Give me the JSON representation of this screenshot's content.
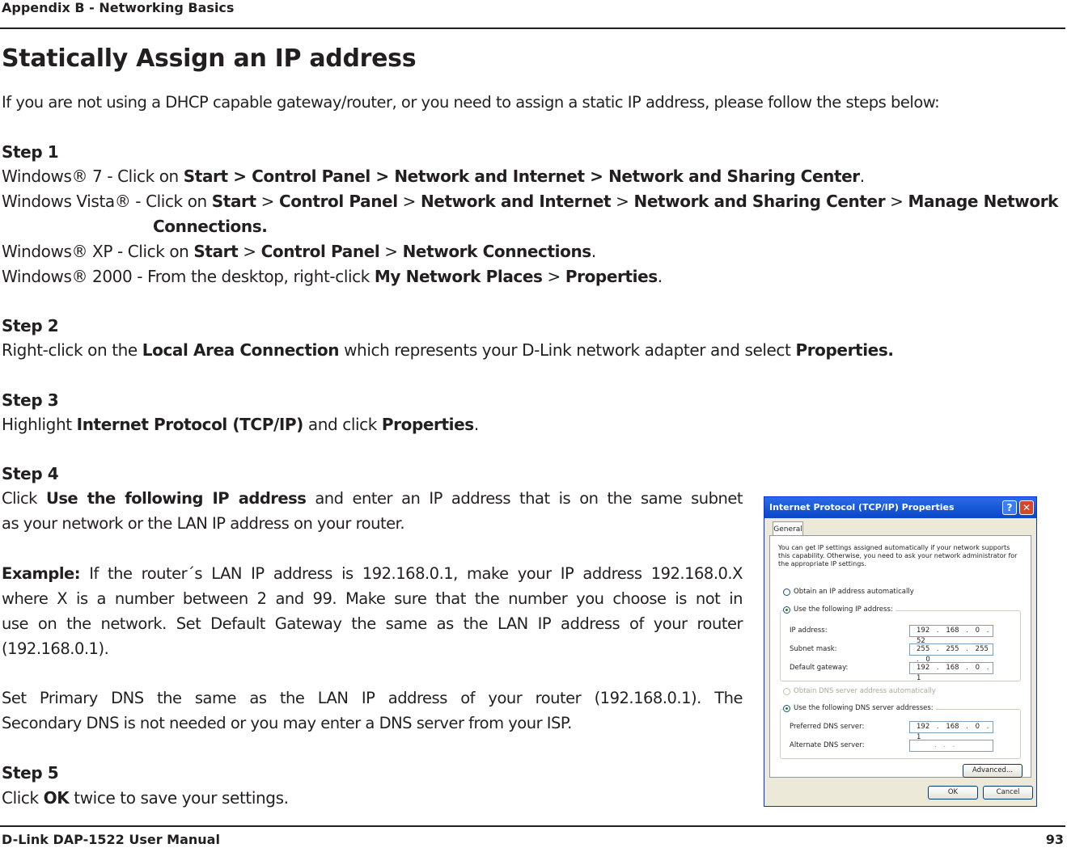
{
  "header": {
    "section": "Appendix B - Networking Basics"
  },
  "title": "Statically Assign an IP address",
  "intro": "If you are not using a DHCP capable gateway/router, or you need to assign a static IP address, please follow the steps below:",
  "step1": {
    "label": "Step 1",
    "win7_prefix": "Windows® 7 - Click on ",
    "win7_path": "Start > Control Panel > Network and Internet > Network and Sharing Center",
    "vista_prefix": "Windows Vista® - Click on ",
    "vista_start": "Start",
    "vista_control": "Control Panel",
    "vista_network": "Network and Internet",
    "vista_sharing": "Network and Sharing Center",
    "vista_manage": "Manage Network",
    "vista_manage2": "Connections.",
    "xp_prefix": "Windows® XP - Click on ",
    "xp_start": "Start",
    "xp_control": "Control Panel",
    "xp_connections": "Network Connections",
    "w2k_prefix": "Windows® 2000 - From the desktop, right-click ",
    "w2k_places": "My Network Places",
    "w2k_props": "Properties"
  },
  "step2": {
    "label": "Step 2",
    "prefix": "Right-click on the ",
    "lac": "Local Area Connection",
    "middle": " which represents your D-Link network adapter and select ",
    "props": "Properties."
  },
  "step3": {
    "label": "Step 3",
    "prefix": "Highlight ",
    "protocol": "Internet Protocol (TCP/IP)",
    "middle": " and click ",
    "props": "Properties"
  },
  "step4": {
    "label": "Step 4",
    "l1_prefix": "Click ",
    "l1_bold": "Use the following IP address",
    "l1_rest": " and enter an IP address that is on the same subnet",
    "l2": "as your network or the LAN IP address on your router.",
    "ex_label": "Example:",
    "ex_l1": " If the router´s LAN IP address is 192.168.0.1, make your IP address 192.168.0.X",
    "ex_l2": "where X is a number between 2 and 99. Make sure that the number you choose is not in",
    "ex_l3": "use on the network. Set Default Gateway the same as the LAN IP address of your router",
    "ex_l4": "(192.168.0.1).",
    "dns_l1": "Set Primary DNS the same as the LAN IP address of your router (192.168.0.1). The",
    "dns_l2": "Secondary DNS is not needed or you may enter a DNS server from your ISP."
  },
  "step5": {
    "label": "Step 5",
    "prefix": "Click ",
    "ok": "OK",
    "rest": " twice to save your settings."
  },
  "dialog": {
    "title": "Internet Protocol (TCP/IP) Properties",
    "help": "?",
    "close": "✕",
    "tab": "General",
    "description": "You can get IP settings assigned automatically if your network supports this capability. Otherwise, you need to ask your network administrator for the appropriate IP settings.",
    "obtain_ip": "Obtain an IP address automatically",
    "use_ip": "Use the following IP address:",
    "ip_label": "IP address:",
    "ip_value": "192 . 168 . 0 . 52",
    "mask_label": "Subnet mask:",
    "mask_value": "255 . 255 . 255 . 0",
    "gw_label": "Default gateway:",
    "gw_value": "192 . 168 . 0 . 1",
    "obtain_dns": "Obtain DNS server address automatically",
    "use_dns": "Use the following DNS server addresses:",
    "pdns_label": "Preferred DNS server:",
    "pdns_value": "192 . 168 . 0 . 1",
    "adns_label": "Alternate DNS server:",
    "adns_value": ". . .",
    "advanced": "Advanced...",
    "ok": "OK",
    "cancel": "Cancel"
  },
  "footer": {
    "manual": "D-Link DAP-1522 User Manual",
    "page": "93"
  }
}
